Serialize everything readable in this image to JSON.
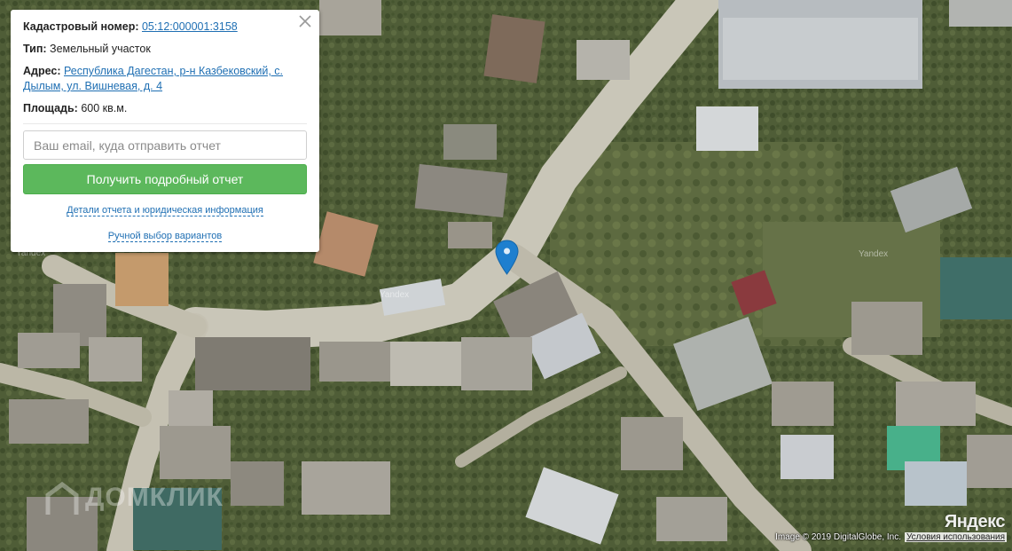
{
  "popup": {
    "cadastral_label": "Кадастровый номер:",
    "cadastral_value": "05:12:000001:3158",
    "type_label": "Тип:",
    "type_value": "Земельный участок",
    "address_label": "Адрес:",
    "address_value_line1": "Республика Дагестан, р-н Казбековский, с.",
    "address_value_line2": "Дылым, ул. Вишневая, д. 4",
    "area_label": "Площадь:",
    "area_value": "600 кв.м.",
    "email_placeholder": "Ваш email, куда отправить отчет",
    "email_value": "",
    "submit_label": "Получить подробный отчет",
    "details_link": "Детали отчета и юридическая информация",
    "manual_link": "Ручной выбор вариантов",
    "close_icon": "close-icon"
  },
  "map": {
    "marker_icon": "map-pin-icon",
    "marker_color": "#1e7fcf",
    "yandex_logo": "Яндекс",
    "copyright": "Image © 2019 DigitalGlobe, Inc.",
    "terms_link": "Условия использования",
    "tile_watermarks": [
      "Yandex",
      "Yandex",
      "Yandex"
    ],
    "brand_watermark": "ДОМКЛИК"
  }
}
